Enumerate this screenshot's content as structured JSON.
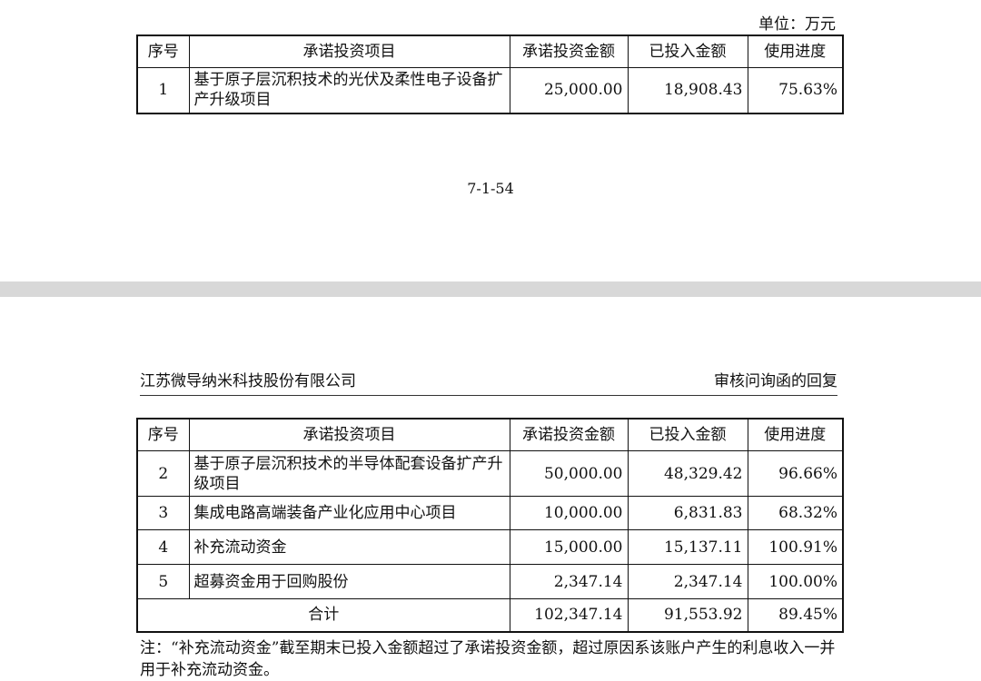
{
  "top": {
    "unit": "单位：万元",
    "headers": [
      "序号",
      "承诺投资项目",
      "承诺投资金额",
      "已投入金额",
      "使用进度"
    ],
    "rows": [
      {
        "idx": "1",
        "name": "基于原子层沉积技术的光伏及柔性电子设备扩产升级项目",
        "committed": "25,000.00",
        "invested": "18,908.43",
        "progress": "75.63%"
      }
    ],
    "page_number": "7-1-54"
  },
  "bottom": {
    "company": "江苏微导纳米科技股份有限公司",
    "doc_title": "审核问询函的回复",
    "headers": [
      "序号",
      "承诺投资项目",
      "承诺投资金额",
      "已投入金额",
      "使用进度"
    ],
    "rows": [
      {
        "idx": "2",
        "name": "基于原子层沉积技术的半导体配套设备扩产升级项目",
        "committed": "50,000.00",
        "invested": "48,329.42",
        "progress": "96.66%"
      },
      {
        "idx": "3",
        "name": "集成电路高端装备产业化应用中心项目",
        "committed": "10,000.00",
        "invested": "6,831.83",
        "progress": "68.32%"
      },
      {
        "idx": "4",
        "name": "补充流动资金",
        "committed": "15,000.00",
        "invested": "15,137.11",
        "progress": "100.91%"
      },
      {
        "idx": "5",
        "name": "超募资金用于回购股份",
        "committed": "2,347.14",
        "invested": "2,347.14",
        "progress": "100.00%"
      }
    ],
    "total": {
      "label": "合计",
      "committed": "102,347.14",
      "invested": "91,553.92",
      "progress": "89.45%"
    },
    "note": "注：“补充流动资金”截至期末已投入金额超过了承诺投资金额，超过原因系该账户产生的利息收入一并用于补充流动资金。"
  }
}
